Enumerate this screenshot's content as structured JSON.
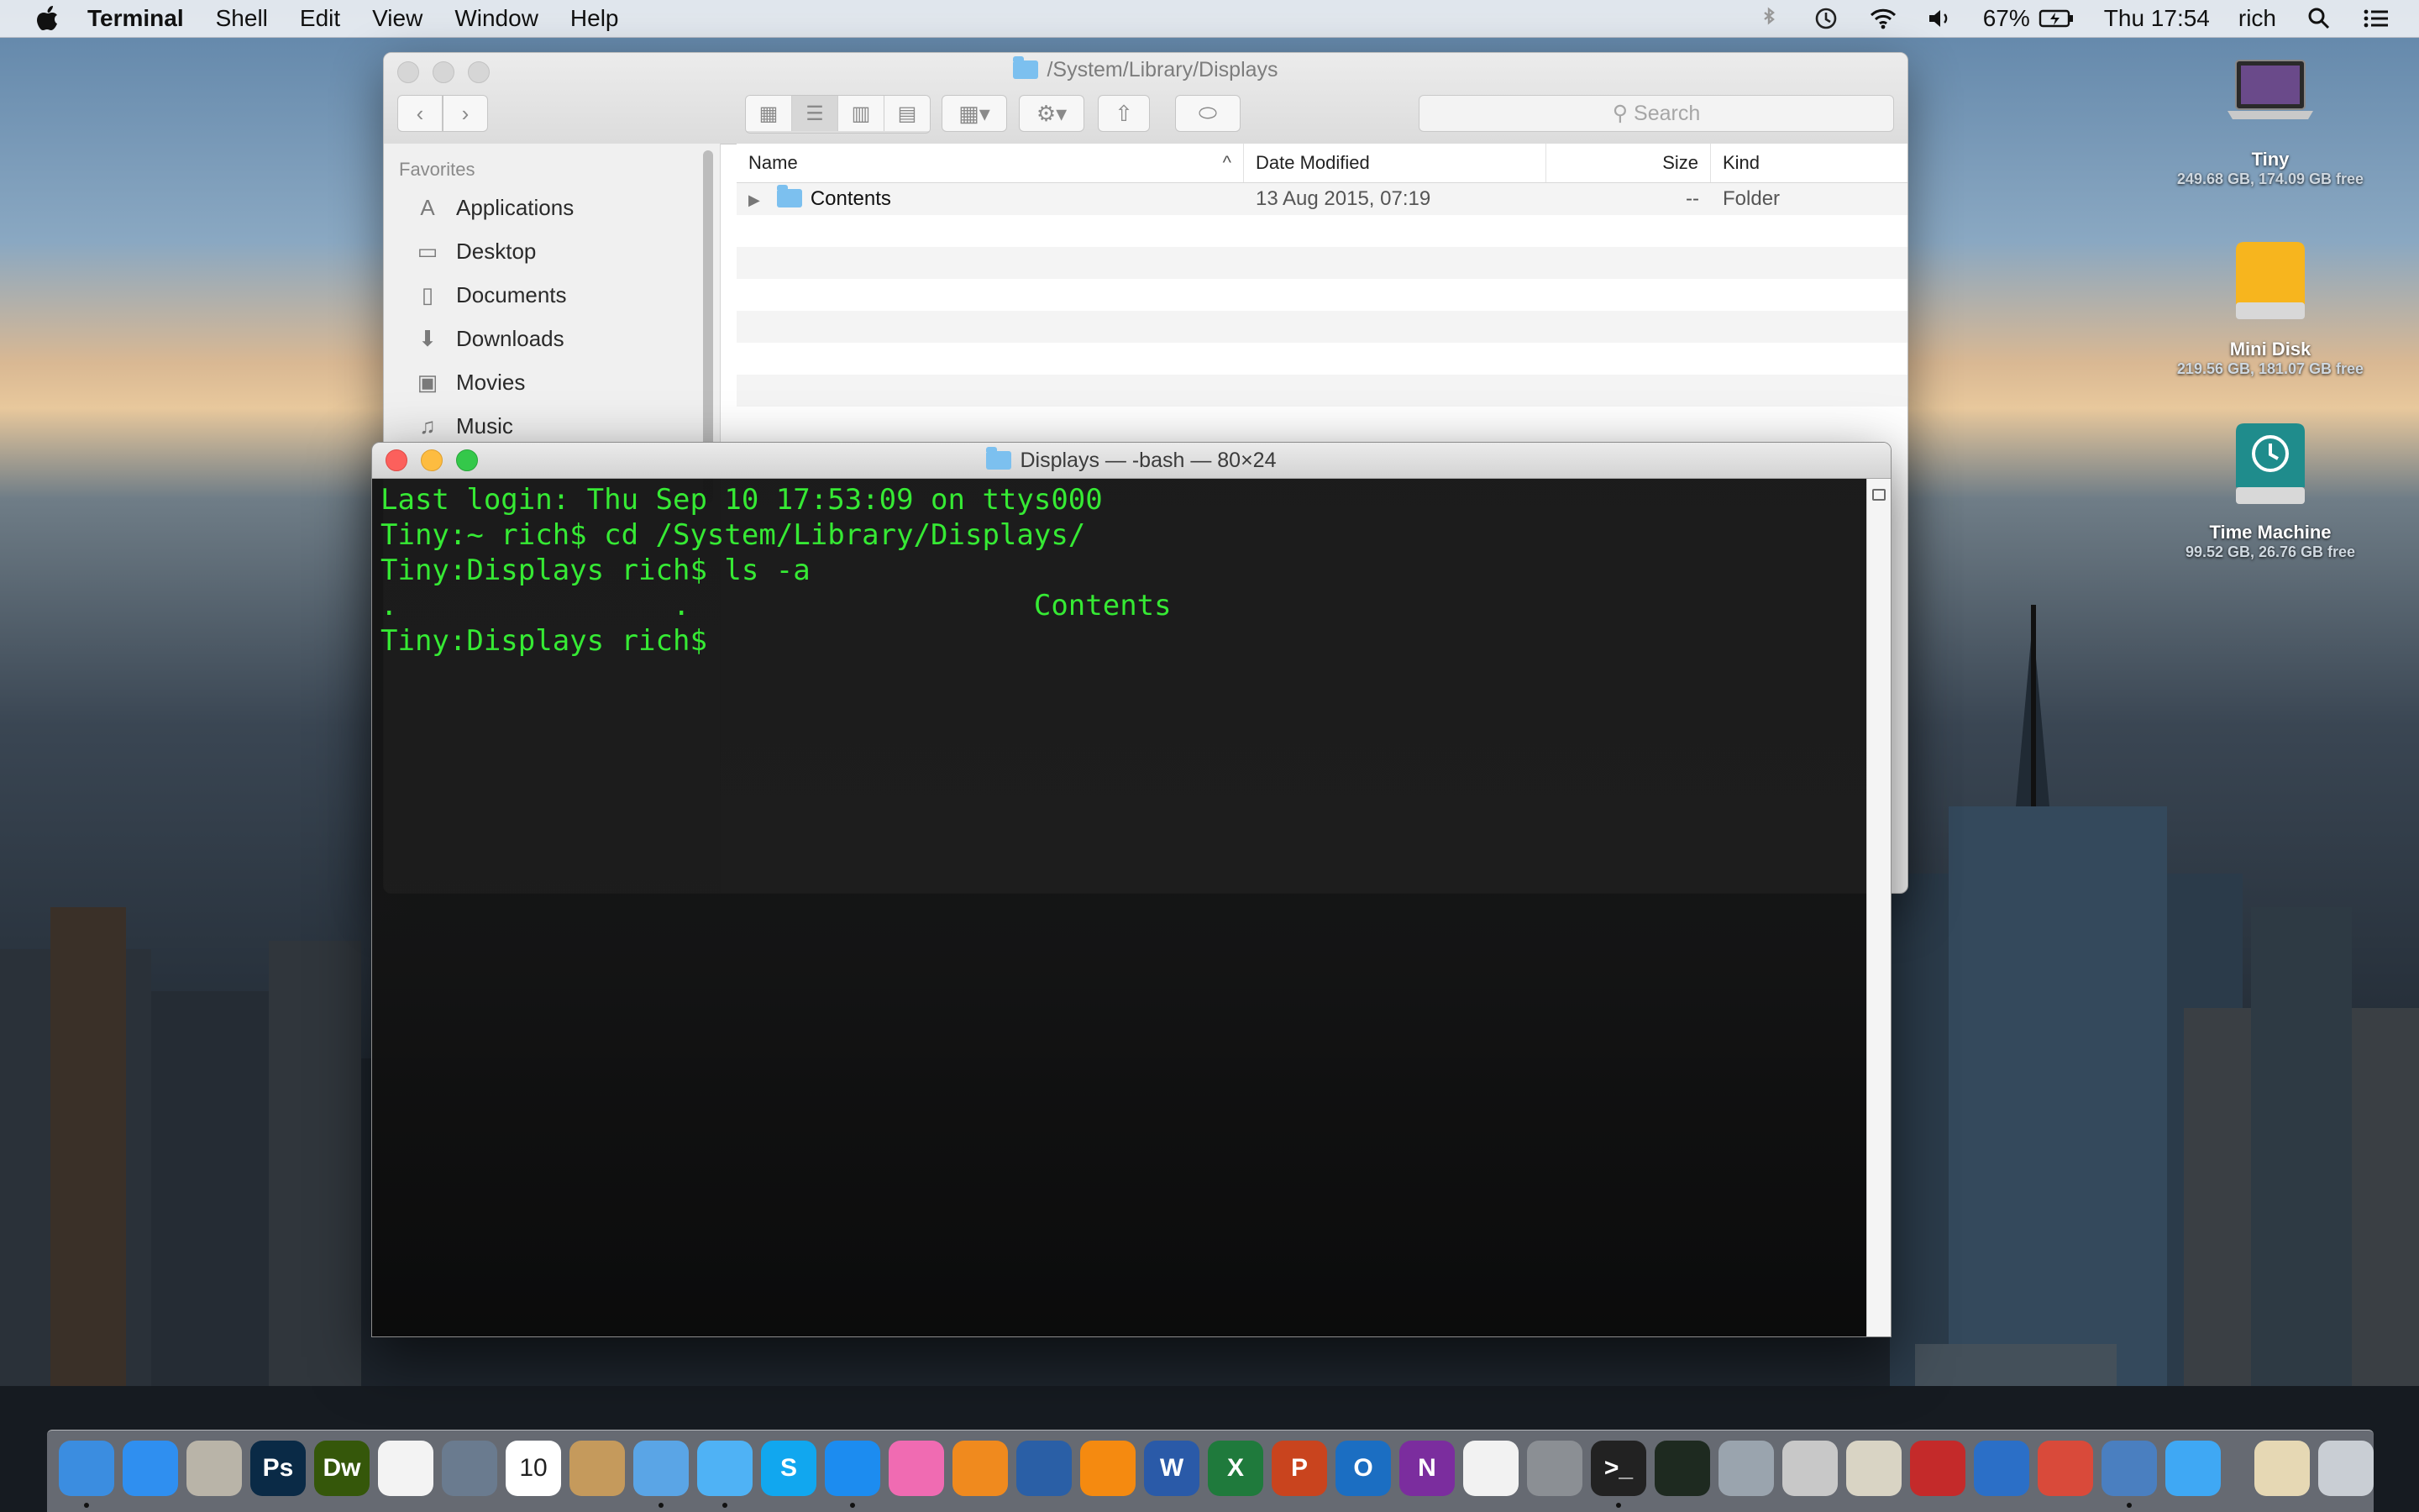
{
  "menubar": {
    "app_name": "Terminal",
    "menus": [
      "Shell",
      "Edit",
      "View",
      "Window",
      "Help"
    ],
    "battery": "67%",
    "clock": "Thu 17:54",
    "user": "rich"
  },
  "finder": {
    "title": "/System/Library/Displays",
    "search_placeholder": "Search",
    "sidebar": {
      "heading": "Favorites",
      "items": [
        {
          "label": "Applications",
          "icon": "applications-icon"
        },
        {
          "label": "Desktop",
          "icon": "desktop-icon"
        },
        {
          "label": "Documents",
          "icon": "documents-icon"
        },
        {
          "label": "Downloads",
          "icon": "downloads-icon"
        },
        {
          "label": "Movies",
          "icon": "movies-icon"
        },
        {
          "label": "Music",
          "icon": "music-icon"
        }
      ]
    },
    "columns": {
      "name": "Name",
      "date": "Date Modified",
      "size": "Size",
      "kind": "Kind"
    },
    "rows": [
      {
        "name": "Contents",
        "date": "13 Aug 2015, 07:19",
        "size": "--",
        "kind": "Folder"
      }
    ]
  },
  "terminal": {
    "title": "Displays — -bash — 80×24",
    "lines": [
      "Last login: Thu Sep 10 17:53:09 on ttys000",
      "Tiny:~ rich$ cd /System/Library/Displays/",
      "Tiny:Displays rich$ ls -a",
      ".                .                    Contents",
      "Tiny:Displays rich$ "
    ]
  },
  "desktop": {
    "items": [
      {
        "name": "Tiny",
        "info": "249.68 GB, 174.09 GB free",
        "icon": "laptop-icon"
      },
      {
        "name": "Mini Disk",
        "info": "219.56 GB, 181.07 GB free",
        "icon": "external-disk-icon"
      },
      {
        "name": "Time Machine",
        "info": "99.52 GB, 26.76 GB free",
        "icon": "time-machine-disk-icon"
      }
    ]
  },
  "dock": {
    "apps": [
      {
        "name": "finder",
        "label": "",
        "color": "#3b8de0"
      },
      {
        "name": "app-store",
        "label": "",
        "color": "#2f8ff0"
      },
      {
        "name": "archive-utility",
        "label": "",
        "color": "#b9b4a8"
      },
      {
        "name": "photoshop",
        "label": "Ps",
        "color": "#0a2a46"
      },
      {
        "name": "dreamweaver",
        "label": "Dw",
        "color": "#35570a"
      },
      {
        "name": "photos",
        "label": "",
        "color": "#f3f3f3"
      },
      {
        "name": "preview",
        "label": "",
        "color": "#6a7b8f"
      },
      {
        "name": "calendar",
        "label": "10",
        "color": "#ffffff"
      },
      {
        "name": "contacts",
        "label": "",
        "color": "#c59a5c"
      },
      {
        "name": "mail",
        "label": "",
        "color": "#5aa5e6"
      },
      {
        "name": "messages",
        "label": "",
        "color": "#4fb2f5"
      },
      {
        "name": "skype",
        "label": "S",
        "color": "#11a7ef"
      },
      {
        "name": "safari",
        "label": "",
        "color": "#1c8cf0"
      },
      {
        "name": "itunes",
        "label": "",
        "color": "#f06bb2"
      },
      {
        "name": "ibooks",
        "label": "",
        "color": "#f08a1e"
      },
      {
        "name": "quicktime",
        "label": "",
        "color": "#2a5fa6"
      },
      {
        "name": "vlc",
        "label": "",
        "color": "#f58a10"
      },
      {
        "name": "word",
        "label": "W",
        "color": "#2a5aa8"
      },
      {
        "name": "excel",
        "label": "X",
        "color": "#1f7a3c"
      },
      {
        "name": "powerpoint",
        "label": "P",
        "color": "#c9441e"
      },
      {
        "name": "outlook",
        "label": "O",
        "color": "#1b6ec2"
      },
      {
        "name": "onenote",
        "label": "N",
        "color": "#7b2d9e"
      },
      {
        "name": "textedit",
        "label": "",
        "color": "#f2f2f2"
      },
      {
        "name": "system-preferences",
        "label": "",
        "color": "#8b8f94"
      },
      {
        "name": "terminal",
        "label": ">_",
        "color": "#222222"
      },
      {
        "name": "activity-monitor",
        "label": "",
        "color": "#1e2a20"
      },
      {
        "name": "disk-utility",
        "label": "",
        "color": "#9aa4ae"
      },
      {
        "name": "automator",
        "label": "",
        "color": "#c8c8c8"
      },
      {
        "name": "network-utility",
        "label": "",
        "color": "#d9d4c4"
      },
      {
        "name": "photo-booth",
        "label": "",
        "color": "#c42a2a"
      },
      {
        "name": "migration-assistant",
        "label": "",
        "color": "#2b6fc7"
      },
      {
        "name": "remote-desktop",
        "label": "",
        "color": "#d94a3a"
      },
      {
        "name": "screen-sharing",
        "label": "",
        "color": "#4a7fc0"
      },
      {
        "name": "twitter",
        "label": "",
        "color": "#3fa8f4"
      },
      {
        "name": "home-folder",
        "label": "",
        "color": "#e6d8b4"
      },
      {
        "name": "trash",
        "label": "",
        "color": "#c9ced4"
      }
    ]
  }
}
